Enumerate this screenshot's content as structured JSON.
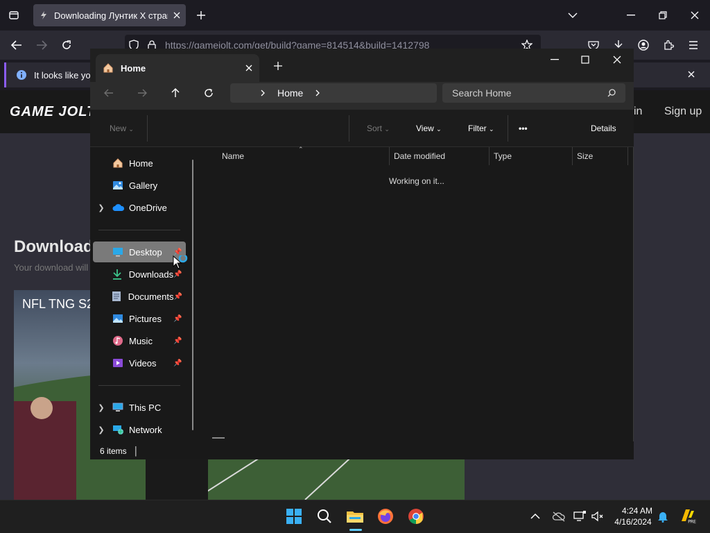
{
  "browser": {
    "tab_title": "Downloading Лунтик X страш",
    "url": "https://gamejolt.com/get/build?game=814514&build=1412798",
    "notice_text": "It looks like you"
  },
  "website": {
    "logo": "GAME JOLT",
    "signin_label": "in",
    "signup_label": "Sign up",
    "download_title": "Download",
    "download_sub": "Your download will",
    "video_title": "NFL TNG S2"
  },
  "explorer": {
    "tab_title": "Home",
    "breadcrumb": "Home",
    "search_placeholder": "Search Home",
    "cmd": {
      "new": "New",
      "sort": "Sort",
      "view": "View",
      "filter": "Filter",
      "more": "•••",
      "details": "Details"
    },
    "nav": {
      "home": "Home",
      "gallery": "Gallery",
      "onedrive": "OneDrive",
      "desktop": "Desktop",
      "downloads": "Downloads",
      "documents": "Documents",
      "pictures": "Pictures",
      "music": "Music",
      "videos": "Videos",
      "thispc": "This PC",
      "network": "Network"
    },
    "columns": {
      "name": "Name",
      "date": "Date modified",
      "type": "Type",
      "size": "Size"
    },
    "working_text": "Working on it...",
    "status": "6 items"
  },
  "taskbar": {
    "time": "4:24 AM",
    "date": "4/16/2024"
  },
  "colors": {
    "accent_blue": "#0078d4",
    "firefox_dark": "#1c1b22",
    "explorer_bg": "#191919",
    "notice_border": "#8b5cf6"
  }
}
